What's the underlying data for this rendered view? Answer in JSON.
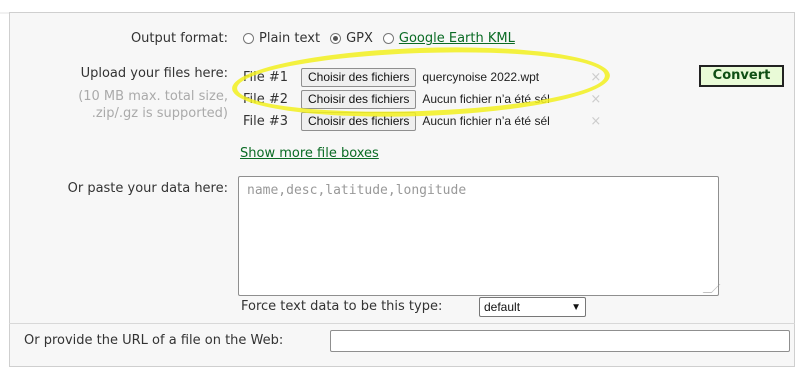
{
  "output_format": {
    "label": "Output format:",
    "options": [
      {
        "label": "Plain text",
        "selected": false
      },
      {
        "label": "GPX",
        "selected": true
      },
      {
        "label": "Google Earth KML",
        "selected": false
      }
    ]
  },
  "upload": {
    "label": "Upload your files here:",
    "hint_line1": "(10 MB max. total size,",
    "hint_line2": ".zip/.gz is supported)",
    "files": [
      {
        "label": "File #1",
        "button": "Choisir des fichiers",
        "status": "quercynoise 2022.wpt"
      },
      {
        "label": "File #2",
        "button": "Choisir des fichiers",
        "status": "Aucun fichier n’a été sél"
      },
      {
        "label": "File #3",
        "button": "Choisir des fichiers",
        "status": "Aucun fichier n’a été sél"
      }
    ],
    "clear_icon": "×",
    "more_link": "Show more file boxes"
  },
  "convert_button": "Convert",
  "paste": {
    "label": "Or paste your data here:",
    "placeholder": "name,desc,latitude,longitude"
  },
  "force_type": {
    "label": "Force text data to be this type:",
    "selected": "default"
  },
  "url": {
    "label": "Or provide the URL of a file on the Web:",
    "value": ""
  },
  "colors": {
    "highlight": "#f2f01e",
    "convert_bg": "#e9fbd7",
    "link": "#0a6b24"
  }
}
